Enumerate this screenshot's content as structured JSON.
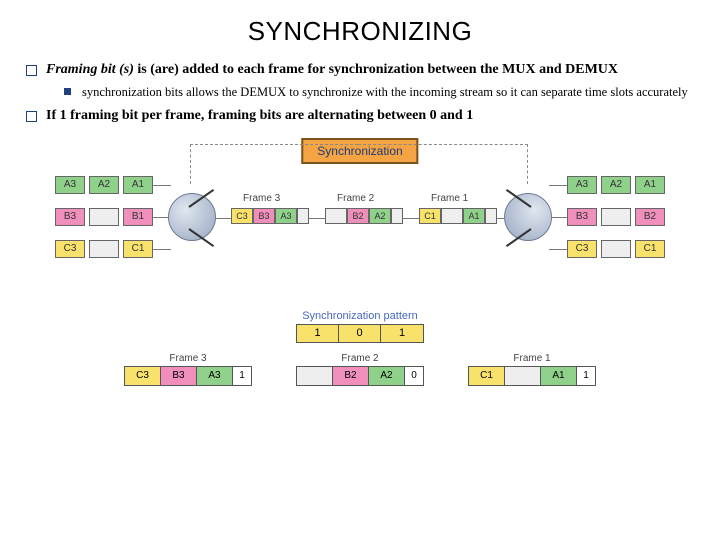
{
  "title": "SYNCHRONIZING",
  "bullets": {
    "b1_prefix_italic": "Framing bit (s)",
    "b1_rest": " is (are) added to each frame for synchronization between the MUX and DEMUX",
    "b1_sub": "synchronization bits allows the DEMUX to synchronize with the incoming stream so it can separate time slots accurately",
    "b2": "If 1 framing bit per frame, framing bits are alternating between 0 and 1"
  },
  "diagram": {
    "sync_label": "Synchronization",
    "lanesA": [
      "A3",
      "A2",
      "A1"
    ],
    "lanesB": [
      "B3",
      "",
      "B1"
    ],
    "lanesC": [
      "C3",
      "",
      "C1"
    ],
    "right_lanesA": [
      "A3",
      "A2",
      "A1"
    ],
    "right_lanesB": [
      "B3",
      "",
      "B2"
    ],
    "right_lanesC": [
      "C3",
      "",
      "C1"
    ],
    "frames": {
      "3": [
        "C3",
        "B3",
        "A3"
      ],
      "2": [
        "",
        "B2",
        "A2"
      ],
      "1": [
        "C1",
        "",
        "A1"
      ]
    },
    "frame_labels": [
      "Frame 3",
      "Frame 2",
      "Frame 1"
    ]
  },
  "sync_pattern": {
    "label": "Synchronization pattern",
    "bits": [
      "1",
      "0",
      "1"
    ]
  },
  "bottom_frames": [
    {
      "label": "Frame 3",
      "cells": [
        {
          "t": "C3",
          "c": "yellow"
        },
        {
          "t": "B3",
          "c": "pink"
        },
        {
          "t": "A3",
          "c": "green"
        },
        {
          "t": "1",
          "c": "white",
          "bit": true
        }
      ]
    },
    {
      "label": "Frame 2",
      "cells": [
        {
          "t": "",
          "c": "grey"
        },
        {
          "t": "B2",
          "c": "pink"
        },
        {
          "t": "A2",
          "c": "green"
        },
        {
          "t": "0",
          "c": "white",
          "bit": true
        }
      ]
    },
    {
      "label": "Frame 1",
      "cells": [
        {
          "t": "C1",
          "c": "yellow"
        },
        {
          "t": "",
          "c": "grey"
        },
        {
          "t": "A1",
          "c": "green"
        },
        {
          "t": "1",
          "c": "white",
          "bit": true
        }
      ]
    }
  ]
}
